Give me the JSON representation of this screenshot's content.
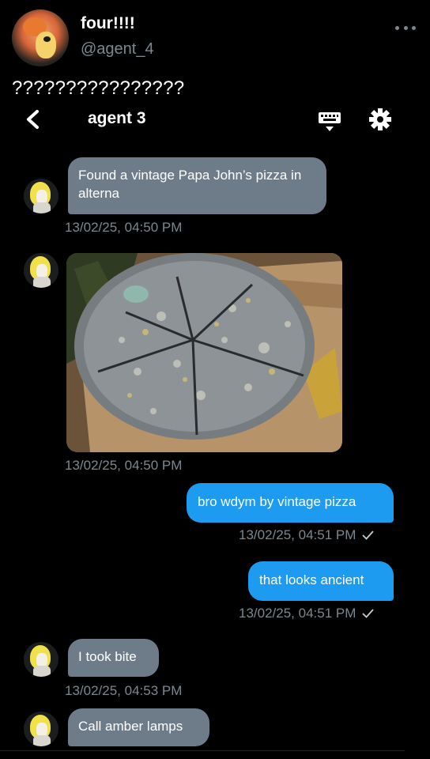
{
  "post": {
    "display_name": "four!!!!",
    "handle": "@agent_4",
    "text": "????????????????"
  },
  "conversation": {
    "title": "agent 3",
    "messages": [
      {
        "direction": "in",
        "type": "text",
        "text": "Found a vintage Papa John’s pizza in alterna",
        "timestamp": "13/02/25, 04:50 PM"
      },
      {
        "direction": "in",
        "type": "image",
        "timestamp": "13/02/25, 04:50 PM"
      },
      {
        "direction": "out",
        "type": "text",
        "text": "bro wdym by vintage pizza",
        "timestamp": "13/02/25, 04:51 PM"
      },
      {
        "direction": "out",
        "type": "text",
        "text": "that looks ancient",
        "timestamp": "13/02/25, 04:51 PM"
      },
      {
        "direction": "in",
        "type": "text",
        "text": "I took bite",
        "timestamp": "13/02/25, 04:53 PM"
      },
      {
        "direction": "in",
        "type": "text",
        "text": "Call amber lamps"
      }
    ]
  },
  "icons": {
    "more": "more-horizontal-icon",
    "back": "back-arrow-icon",
    "keyboard": "keyboard-icon",
    "settings": "settings-gear-icon",
    "sent": "checkmark-icon"
  },
  "colors": {
    "background": "#000000",
    "incoming_bubble": "#6e7c8a",
    "outgoing_bubble": "#1d9bf0",
    "muted_text": "#7d8790"
  }
}
